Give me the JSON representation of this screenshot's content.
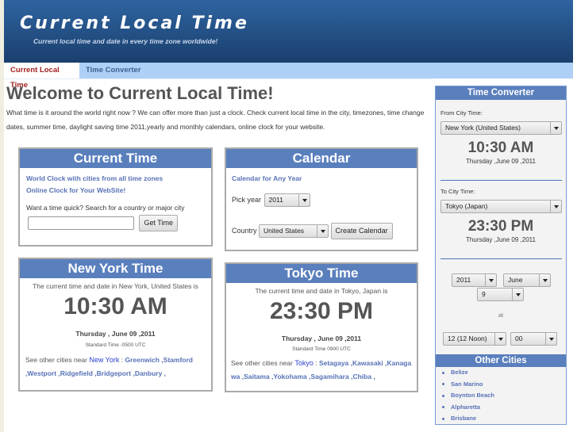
{
  "header": {
    "title": "Current Local Time",
    "tagline": "Current local time and date in every time zone worldwide!"
  },
  "nav": {
    "tabs": [
      {
        "label": "Current Local Time",
        "active": true
      },
      {
        "label": "Time Converter",
        "active": false
      }
    ]
  },
  "main": {
    "heading": "Welcome to Current Local Time!",
    "intro": "What time is it around the world right now ? We can offer more than just a clock. Check current local time in the city, timezones, time change dates, summer time, daylight saving time 2011,yearly and monthly calendars, online clock for your website."
  },
  "current_time_box": {
    "title": "Current Time",
    "link1": "World Clock with cities from all time zones",
    "link2": "Online Clock for Your WebSite!",
    "prompt": "Want a time quick? Search for a country or major city",
    "search_value": "",
    "button": "Get Time"
  },
  "calendar_box": {
    "title": "Calendar",
    "link": "Calendar for Any Year",
    "year_label": "Pick year",
    "year_value": "2011",
    "country_label": "Country",
    "country_value": "United States",
    "button": "Create Calendar"
  },
  "newyork_box": {
    "title": "New York Time",
    "desc": "The current time and date in New York, United States is",
    "time": "10:30 AM",
    "date": "Thursday , June 09 ,2011",
    "std": "Standard Time -0500 UTC",
    "near_prefix": "See other cities near",
    "city": "New York",
    "sep": " : ",
    "nearby": [
      "Greenwich",
      "Stamford",
      "Westport",
      "Ridgefield",
      "Bridgeport",
      "Danbury"
    ]
  },
  "tokyo_box": {
    "title": "Tokyo Time",
    "desc": "The current time and date in Tokyo, Japan is",
    "time": "23:30 PM",
    "date": "Thursday , June 09 ,2011",
    "std": "Standard Time 0900 UTC",
    "near_prefix": "See other cities near",
    "city": "Tokyo",
    "sep": " : ",
    "nearby": [
      "Setagaya",
      "Kawasaki",
      "Kanagawa",
      "Saitama",
      "Yokohama",
      "Sagamihara",
      "Chiba"
    ]
  },
  "sidebar": {
    "title": "Time Converter",
    "from_label": "From City Time:",
    "from_value": "New York (United States)",
    "from_time": "10:30 AM",
    "from_date": "Thursday ,June 09 ,2011",
    "to_label": "To City Time:",
    "to_value": "Tokyo (Japan)",
    "to_time": "23:30 PM",
    "to_date": "Thursday ,June 09 ,2011",
    "year": "2011",
    "month": "June",
    "day": "9",
    "at": "at",
    "hour": "12 (12 Noon)",
    "minute": "00",
    "other_title": "Other Cities",
    "other_cities": [
      "Belize",
      "San Marino",
      "Boynton Beach",
      "Alpharetta",
      "Brisbane"
    ]
  }
}
